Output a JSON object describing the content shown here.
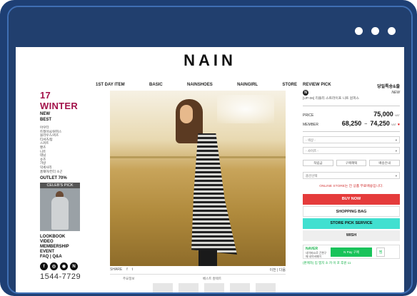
{
  "site": {
    "logo": "NAIN"
  },
  "nav": {
    "items": [
      "1ST DAY ITEM",
      "BASIC",
      "NAINSHOES",
      "NAINGIRL",
      "STORE"
    ],
    "right": [
      "REVIEW PICK",
      "당일특송&출"
    ]
  },
  "sidebar": {
    "season": "17 WINTER",
    "new": "NEW",
    "best": "BEST",
    "categories": [
      "아우터",
      "트레이닝/원피스",
      "블라우스/셔츠",
      "티셔츠/탑",
      "스커트",
      "팬츠",
      "니트",
      "데님",
      "슈즈",
      "가방",
      "악세사리",
      "홈웨어/언더 소곤"
    ],
    "outlet": "OUTLET 70%",
    "celeb_pick": "CELEB'S PICK",
    "links": [
      "LOOKBOOK",
      "VIDEO",
      "MEMBERSHIP",
      "EVENT",
      "FAQ | Q&A"
    ],
    "social": [
      "f",
      "◎",
      "◉",
      "N"
    ],
    "phone": "1544-7729"
  },
  "main": {
    "share": "SHARE",
    "share_icons": [
      "f",
      "t"
    ],
    "pager": "이전 | 다음",
    "thumb_labels": [
      "주요정보",
      "베스트 컬렉트"
    ]
  },
  "product": {
    "badge": "N",
    "new_tag": "NEW",
    "name": "[UP-06] 리플리 스트라이프 니트 원피스",
    "price_label": "PRICE",
    "price": "75,000",
    "member_label": "MEMBER",
    "member_from": "68,250",
    "member_to": "74,250",
    "vat": "VAT",
    "select_color": "- 색상 -",
    "select_size": "- 사이즈 -",
    "option_buttons": [
      "적립금",
      "구매혜택",
      "배송안내"
    ],
    "select_extra": "옵션선택",
    "store_note": "ONLINE STORE는 전 상품 무료배송입니다.",
    "buy_now": "BUY NOW",
    "shopping_bag": "SHOPPING BAG",
    "store_pick": "STORE PICK SERVICE",
    "wish": "WISH",
    "naver_logo": "NAVER",
    "naver_text": "네이버ID로 간편구매 네이버페이",
    "npay_label": "N Pay 구매",
    "naver_wish": "찜",
    "naver_foot": "(판매자) 입 엠지 소 카 이 포 후원 11"
  },
  "colors": {
    "frame": "#1e3f74",
    "season": "#a3124a",
    "buy": "#e53b3b",
    "store_pick": "#41e0d0",
    "naver": "#19c35a"
  }
}
